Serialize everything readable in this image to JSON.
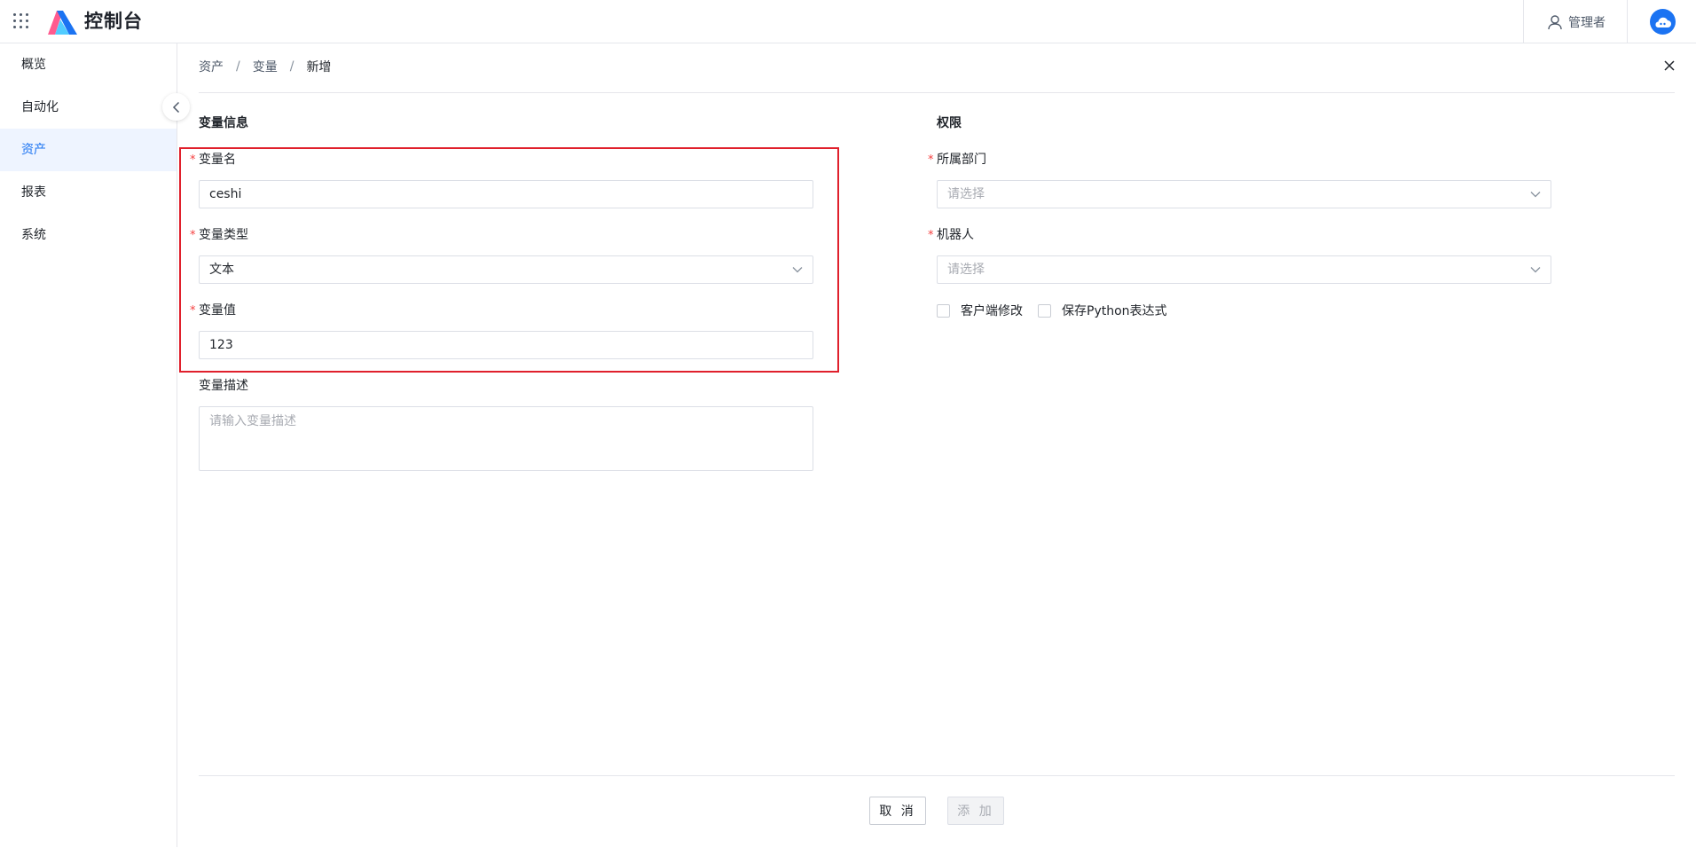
{
  "header": {
    "brand": "控制台",
    "admin_label": "管理者"
  },
  "sidebar": {
    "items": [
      {
        "label": "概览"
      },
      {
        "label": "自动化"
      },
      {
        "label": "资产"
      },
      {
        "label": "报表"
      },
      {
        "label": "系统"
      }
    ],
    "active_index": 2
  },
  "breadcrumb": [
    "资产",
    "变量",
    "新增"
  ],
  "breadcrumb_sep": "/",
  "left_section": {
    "title": "变量信息",
    "name_label": "变量名",
    "name_value": "ceshi",
    "type_label": "变量类型",
    "type_value": "文本",
    "value_label": "变量值",
    "value_value": "123",
    "desc_label": "变量描述",
    "desc_placeholder": "请输入变量描述"
  },
  "right_section": {
    "title": "权限",
    "dept_label": "所属部门",
    "dept_placeholder": "请选择",
    "robot_label": "机器人",
    "robot_placeholder": "请选择",
    "client_modify_label": "客户端修改",
    "save_python_label": "保存Python表达式"
  },
  "required_mark": "*",
  "footer": {
    "cancel_label": "取 消",
    "add_label": "添 加"
  },
  "colors": {
    "accent": "#1b73f2",
    "required": "#f53f3f",
    "highlight": "#e0202c"
  }
}
